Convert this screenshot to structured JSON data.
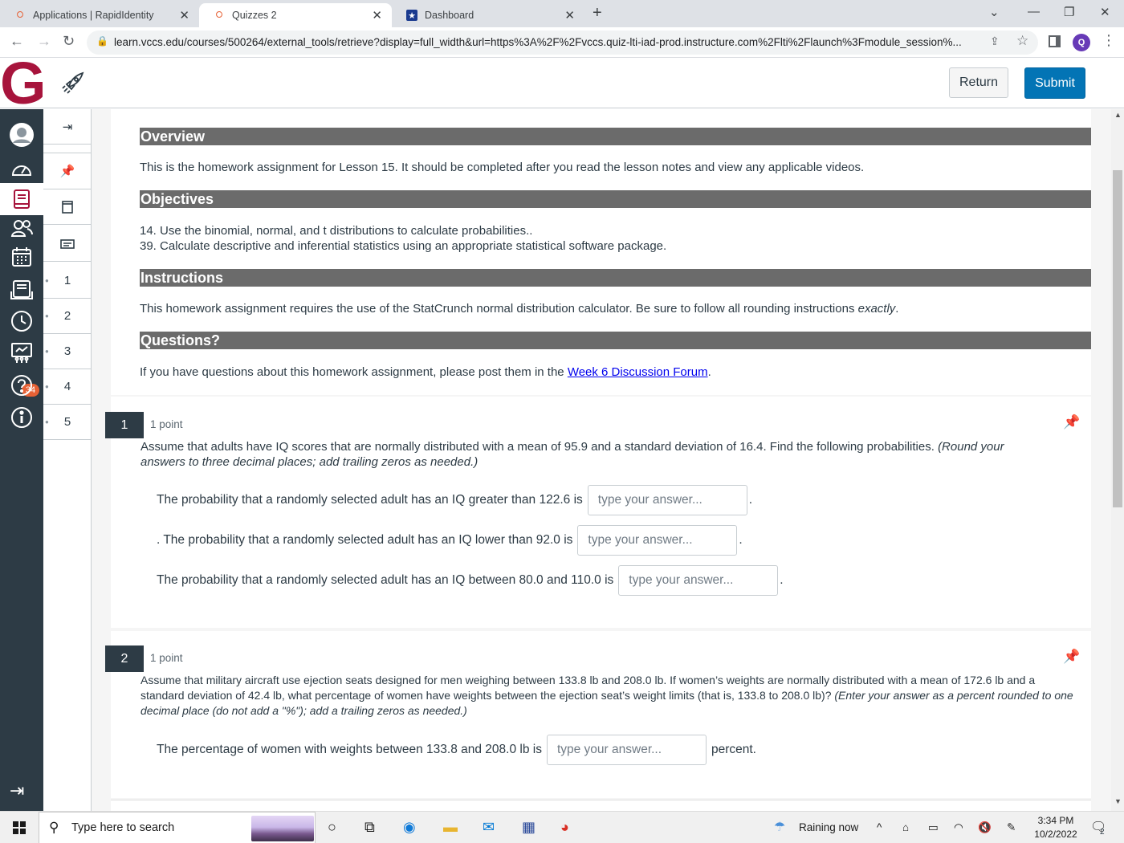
{
  "browser": {
    "tabs": [
      {
        "title": "Applications | RapidIdentity",
        "active": false
      },
      {
        "title": "Quizzes 2",
        "active": true
      },
      {
        "title": "Dashboard",
        "active": false
      }
    ],
    "url": "learn.vccs.edu/courses/500264/external_tools/retrieve?display=full_width&url=https%3A%2F%2Fvccs.quiz-lti-iad-prod.instructure.com%2Flti%2Flaunch%3Fmodule_session%...",
    "profile_initial": "Q"
  },
  "header": {
    "logo": "G",
    "return_label": "Return",
    "submit_label": "Submit"
  },
  "global_nav": {
    "badge_count": "34",
    "items": [
      "account",
      "dashboard",
      "courses",
      "groups",
      "calendar",
      "inbox",
      "history",
      "commons",
      "help",
      "info"
    ]
  },
  "question_nav": {
    "items": [
      "1",
      "2",
      "3",
      "4",
      "5"
    ]
  },
  "intro": {
    "overview_heading": "Overview",
    "overview_text": "This is the homework assignment for Lesson 15. It should be completed after you read the lesson notes and view any applicable videos.",
    "objectives_heading": "Objectives",
    "objective_1": "14. Use the binomial, normal, and t distributions to calculate probabilities..",
    "objective_2": "39. Calculate descriptive and inferential statistics using an appropriate statistical software package.",
    "instructions_heading": "Instructions",
    "instructions_text": "This homework assignment requires the use of the StatCrunch normal distribution calculator. Be sure to follow all rounding instructions ",
    "instructions_emph": "exactly",
    "instructions_end": ".",
    "questions_heading": "Questions?",
    "questions_text": "If you have questions about this homework assignment, please post them in the ",
    "questions_link": "Week 6 Discussion Forum",
    "questions_end": "."
  },
  "questions": [
    {
      "number": "1",
      "points": "1 point",
      "text": "Assume that adults have IQ scores that are normally distributed with a mean of 95.9 and a standard deviation of 16.4. Find the following probabilities. ",
      "text_emph": "(Round your answers to three decimal places; add trailing zeros as needed.)",
      "parts": [
        {
          "prefix": "The probability that a randomly selected adult has an IQ greater than 122.6 is",
          "placeholder": "type your answer...",
          "suffix": "."
        },
        {
          "prefix": ". The probability that a randomly selected adult has an IQ lower than 92.0 is",
          "placeholder": "type your answer...",
          "suffix": "."
        },
        {
          "prefix": "The probability that a randomly selected adult has an IQ between 80.0 and 110.0 is",
          "placeholder": "type your answer...",
          "suffix": "."
        }
      ]
    },
    {
      "number": "2",
      "points": "1 point",
      "text": "Assume that military aircraft use ejection seats designed for men weighing between 133.8 lb and 208.0 lb. If women’s weights are normally distributed with a mean of 172.6 lb and a standard deviation of 42.4 lb, what percentage of women have weights between the ejection seat’s weight limits (that is, 133.8 to 208.0 lb)? ",
      "text_emph": "(Enter your answer as a percent rounded to one decimal place (do not add a \"%\"); add a trailing zeros as needed.)",
      "parts": [
        {
          "prefix": "The percentage of women with weights between 133.8 and 208.0 lb is",
          "placeholder": "type your answer...",
          "suffix": "percent."
        }
      ]
    }
  ],
  "taskbar": {
    "search_placeholder": "Type here to search",
    "weather": "Raining now",
    "time": "3:34 PM",
    "date": "10/2/2022",
    "notification_count": "2"
  },
  "colors": {
    "brand": "#a7143c",
    "nav_bg": "#2d3b45",
    "primary_button": "#0374b5",
    "section_header": "#6b6b6b",
    "badge": "#e66135"
  }
}
